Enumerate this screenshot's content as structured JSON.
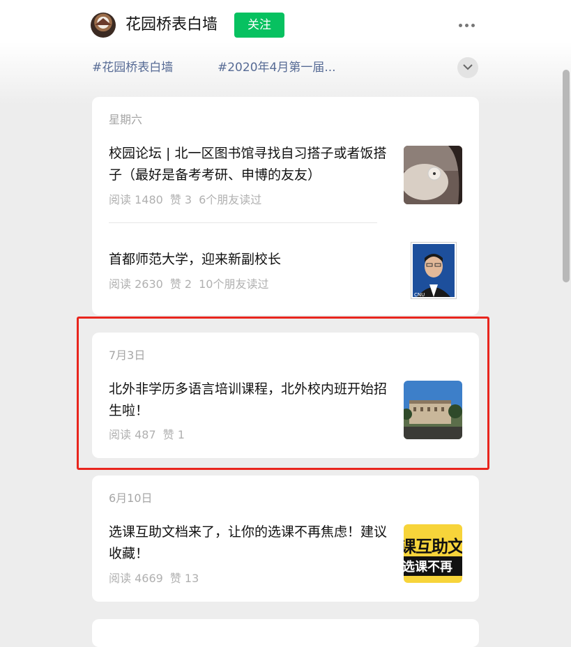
{
  "header": {
    "account_name": "花园桥表白墙",
    "follow_label": "关注"
  },
  "tags": [
    "#花园桥表白墙",
    "#2020年4月第一届..."
  ],
  "groups": [
    {
      "date": "星期六",
      "articles": [
        {
          "title": "校园论坛 | 北一区图书馆寻找自习搭子或者饭搭子（最好是备考考研、申博的友友）",
          "reads": "阅读 1480",
          "likes": "赞 3",
          "friends": "6个朋友读过",
          "thumb_caption": ""
        },
        {
          "title": "首都师范大学，迎来新副校长",
          "reads": "阅读 2630",
          "likes": "赞 2",
          "friends": "10个朋友读过",
          "thumb_caption": "CNU"
        }
      ]
    },
    {
      "date": "7月3日",
      "articles": [
        {
          "title": "北外非学历多语言培训课程，北外校内班开始招生啦！",
          "reads": "阅读 487",
          "likes": "赞 1"
        }
      ]
    },
    {
      "date": "6月10日",
      "articles": [
        {
          "title": "选课互助文档来了，让你的选课不再焦虑！建议收藏！",
          "reads": "阅读 4669",
          "likes": "赞 13",
          "thumb_text_top": "课互助文",
          "thumb_text_bottom": "选课不再"
        }
      ]
    }
  ],
  "colors": {
    "follow_green": "#07c160",
    "tag_blue": "#576b95",
    "highlight_red": "#e8251d",
    "background": "#ededed"
  }
}
